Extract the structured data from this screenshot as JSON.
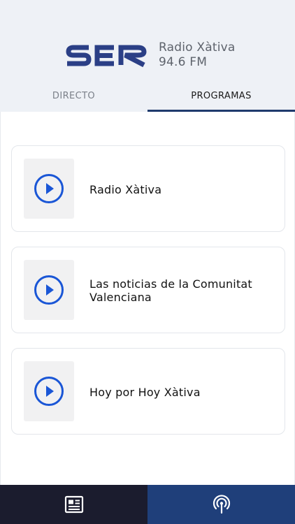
{
  "header": {
    "logo_text": "SER",
    "station_name": "Radio Xàtiva",
    "station_freq": "94.6 FM"
  },
  "tabs": [
    {
      "label": "DIRECTO",
      "active": false
    },
    {
      "label": "PROGRAMAS",
      "active": true
    }
  ],
  "programs": [
    {
      "title": "Radio Xàtiva",
      "icon": "play-icon"
    },
    {
      "title": "Las noticias de la Comunitat Valenciana",
      "icon": "play-icon"
    },
    {
      "title": "Hoy por Hoy Xàtiva",
      "icon": "play-icon"
    }
  ],
  "bottom_nav": [
    {
      "icon": "news-icon",
      "active": false
    },
    {
      "icon": "broadcast-icon",
      "active": true
    }
  ],
  "colors": {
    "header_bg": "#eef1f6",
    "brand_navy": "#2b3f86",
    "accent_blue": "#1f3f7a",
    "dark_nav": "#1b1c2e",
    "play_blue": "#1a56d6"
  }
}
